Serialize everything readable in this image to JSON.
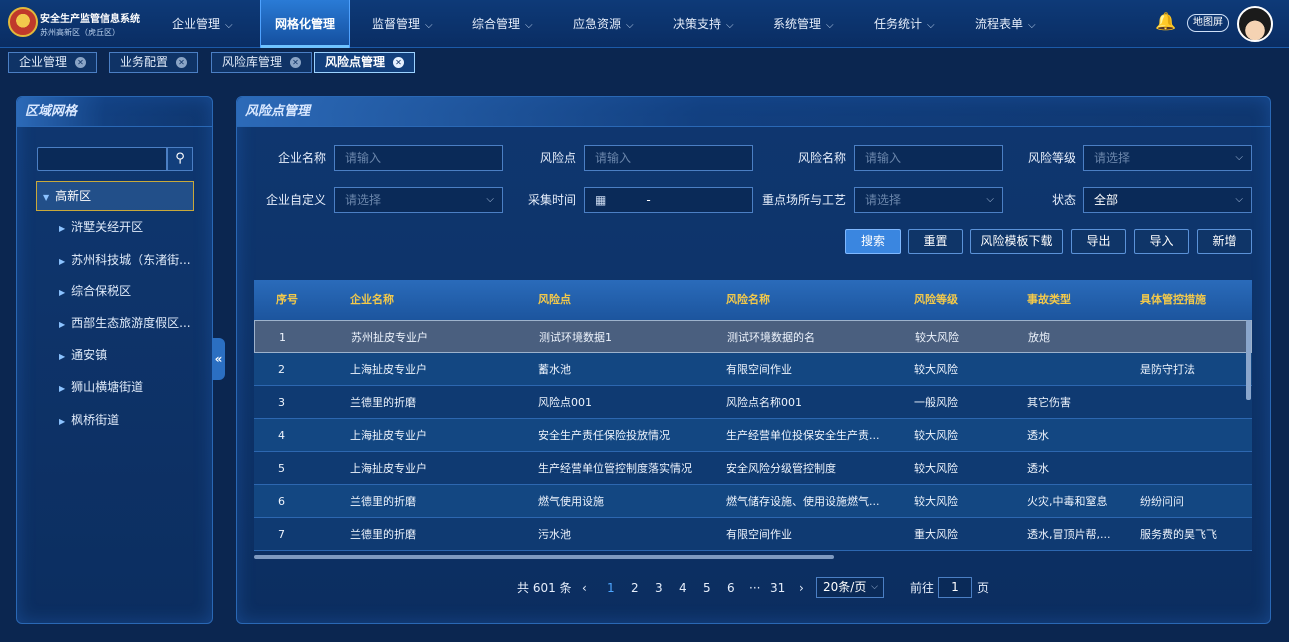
{
  "app": {
    "name": "安全生产监管信息系统",
    "subname": "苏州高新区（虎丘区）"
  },
  "nav": [
    {
      "label": "企业管理",
      "active": false
    },
    {
      "label": "网格化管理",
      "active": true
    },
    {
      "label": "监督管理",
      "active": false
    },
    {
      "label": "综合管理",
      "active": false
    },
    {
      "label": "应急资源",
      "active": false
    },
    {
      "label": "决策支持",
      "active": false
    },
    {
      "label": "系统管理",
      "active": false
    },
    {
      "label": "任务统计",
      "active": false
    },
    {
      "label": "流程表单",
      "active": false
    }
  ],
  "header": {
    "map_label": "地图屏"
  },
  "tabs": [
    {
      "label": "企业管理",
      "active": false
    },
    {
      "label": "业务配置",
      "active": false
    },
    {
      "label": "风险库管理",
      "active": false
    },
    {
      "label": "风险点管理",
      "active": true
    }
  ],
  "left_panel": {
    "title": "区域网格",
    "root": "高新区",
    "items": [
      "浒墅关经开区",
      "苏州科技城（东渚街...",
      "综合保税区",
      "西部生态旅游度假区...",
      "通安镇",
      "狮山横塘街道",
      "枫桥街道"
    ]
  },
  "main_panel": {
    "title": "风险点管理"
  },
  "filters": {
    "company_name": {
      "label": "企业名称",
      "placeholder": "请输入"
    },
    "risk_point": {
      "label": "风险点",
      "placeholder": "请输入"
    },
    "risk_name": {
      "label": "风险名称",
      "placeholder": "请输入"
    },
    "risk_level": {
      "label": "风险等级",
      "placeholder": "请选择"
    },
    "custom": {
      "label": "企业自定义",
      "placeholder": "请选择"
    },
    "collect_time": {
      "label": "采集时间",
      "separator": "-"
    },
    "key_process": {
      "label": "重点场所与工艺",
      "placeholder": "请选择"
    },
    "status": {
      "label": "状态",
      "value": "全部"
    }
  },
  "buttons": {
    "search": "搜索",
    "reset": "重置",
    "template_download": "风险模板下载",
    "export": "导出",
    "import": "导入",
    "add": "新增"
  },
  "table": {
    "columns": [
      "序号",
      "企业名称",
      "风险点",
      "风险名称",
      "风险等级",
      "事故类型",
      "具体管控措施"
    ],
    "rows": [
      [
        "1",
        "苏州扯皮专业户",
        "测试环境数据1",
        "测试环境数据的名",
        "较大风险",
        "放炮",
        ""
      ],
      [
        "2",
        "上海扯皮专业户",
        "蓄水池",
        "有限空间作业",
        "较大风险",
        "",
        "是防守打法"
      ],
      [
        "3",
        "兰德里的折磨",
        "风险点001",
        "风险点名称001",
        "一般风险",
        "其它伤害",
        ""
      ],
      [
        "4",
        "上海扯皮专业户",
        "安全生产责任保险投放情况",
        "生产经营单位投保安全生产责...",
        "较大风险",
        "透水",
        ""
      ],
      [
        "5",
        "上海扯皮专业户",
        "生产经营单位管控制度落实情况",
        "安全风险分级管控制度",
        "较大风险",
        "透水",
        ""
      ],
      [
        "6",
        "兰德里的折磨",
        "燃气使用设施",
        "燃气储存设施、使用设施燃气...",
        "较大风险",
        "火灾,中毒和窒息",
        "纷纷问问"
      ],
      [
        "7",
        "兰德里的折磨",
        "污水池",
        "有限空间作业",
        "重大风险",
        "透水,冒顶片帮,...",
        "服务费的昊飞飞"
      ]
    ]
  },
  "pagination": {
    "total": "共 601 条",
    "pages": [
      "1",
      "2",
      "3",
      "4",
      "5",
      "6",
      "···",
      "31"
    ],
    "current": "1",
    "page_size": "20条/页",
    "goto_label": "前往",
    "goto_value": "1",
    "page_suffix": "页"
  }
}
